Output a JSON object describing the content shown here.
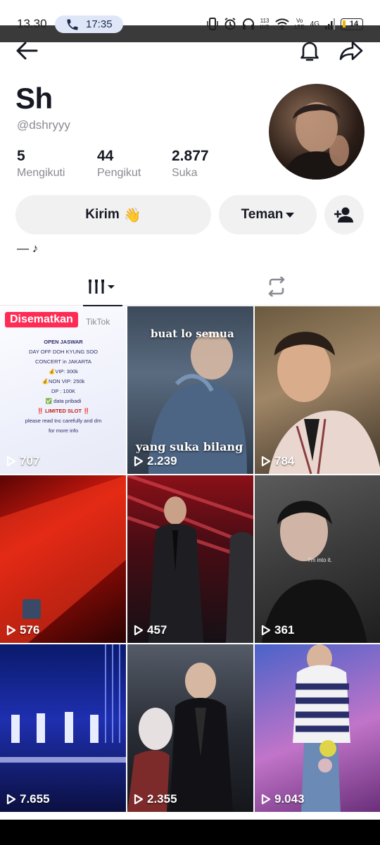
{
  "status_bar": {
    "time": "13.30",
    "call_time": "17:35",
    "net_speed_value": "113",
    "net_speed_unit": "K/S",
    "network_label_top": "Vo",
    "network_label_bottom": "LTE",
    "network_type": "4G",
    "battery_level": "14",
    "battery_color": "#f2b705"
  },
  "nav": {
    "back_icon": "arrow-left-icon",
    "notification_icon": "bell-icon",
    "share_icon": "share-arrow-icon"
  },
  "profile": {
    "name": "Sh",
    "handle": "@dshryyy",
    "stats": [
      {
        "value": "5",
        "label": "Mengikuti"
      },
      {
        "value": "44",
        "label": "Pengikut"
      },
      {
        "value": "2.877",
        "label": "Suka"
      }
    ],
    "bio": "— ♪"
  },
  "actions": {
    "message_label": "Kirim",
    "message_emoji": "👋",
    "friend_label": "Teman",
    "add_friend_icon": "add-user-icon"
  },
  "tabs": {
    "videos_icon": "videos-grid-icon",
    "repost_icon": "repost-icon"
  },
  "videos": [
    {
      "views": "707",
      "pinned_label": "Disematkan",
      "watermark": "TikTok",
      "card_lines": [
        "OPEN JASWAR",
        "DAY OFF DOH KYUNG SOO",
        "CONCERT in JAKARTA",
        "💰VIP: 300k",
        "💰NON VIP: 250k",
        "DP : 100K",
        "✅ data pribadi",
        "‼️ LIMITED SLOT ‼️",
        "please read tnc carefully and dm",
        "for more info"
      ]
    },
    {
      "views": "2.239",
      "caption_top": "buat lo semua",
      "caption_bottom": "yang suka bilang"
    },
    {
      "views": "784"
    },
    {
      "views": "576"
    },
    {
      "views": "457"
    },
    {
      "views": "361",
      "caption_small": "I'm into it."
    },
    {
      "views": "7.655"
    },
    {
      "views": "2.355"
    },
    {
      "views": "9.043"
    }
  ],
  "colors": {
    "primary_text": "#161823",
    "secondary_text": "#8a8b91",
    "button_bg": "#f1f1f2",
    "pinned_badge": "#fe2c55"
  }
}
